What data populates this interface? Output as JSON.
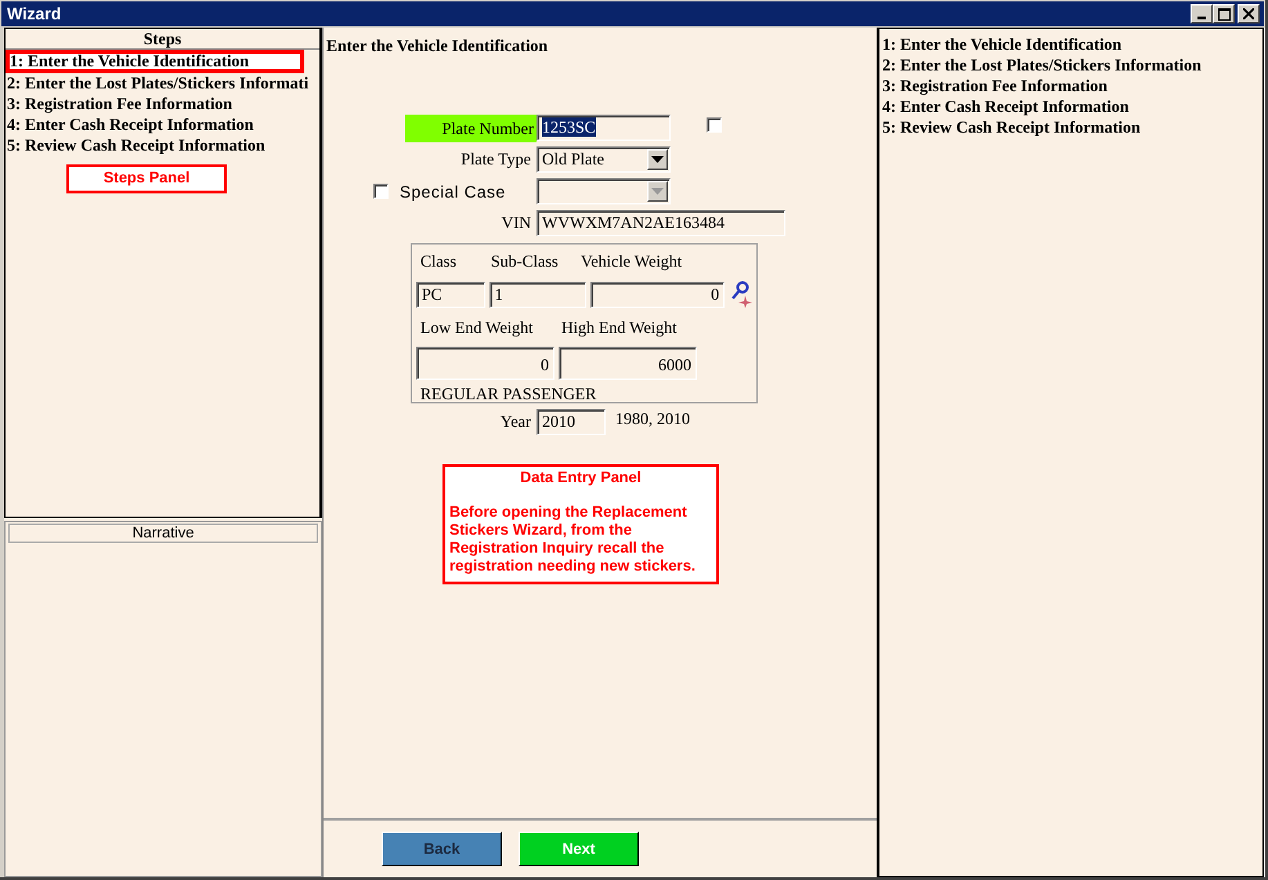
{
  "window": {
    "title": "Wizard"
  },
  "steps_panel": {
    "title": "Steps",
    "items": [
      {
        "label": "1: Enter the Vehicle Identification",
        "selected": true
      },
      {
        "label": "2: Enter the Lost Plates/Stickers Informati",
        "selected": false
      },
      {
        "label": "3: Registration Fee Information",
        "selected": false
      },
      {
        "label": "4: Enter Cash Receipt Information",
        "selected": false
      },
      {
        "label": "5: Review Cash Receipt Information",
        "selected": false
      }
    ],
    "callout": "Steps Panel"
  },
  "narrative": {
    "title": "Narrative"
  },
  "form": {
    "heading": "Enter the Vehicle Identification",
    "plate_number": {
      "label": "Plate Number",
      "value": "1253SC"
    },
    "plate_checkbox": {
      "checked": false
    },
    "plate_type": {
      "label": "Plate Type",
      "value": "Old Plate"
    },
    "special_case": {
      "label": "Special Case",
      "checked": false
    },
    "vin": {
      "label": "VIN",
      "value": "WVWXM7AN2AE163484"
    },
    "class_group": {
      "class_label": "Class",
      "subclass_label": "Sub-Class",
      "weight_label": "Vehicle  Weight",
      "class": "PC",
      "subclass": "1",
      "weight": "0",
      "low_label": "Low End Weight",
      "high_label": "High End Weight",
      "low": "0",
      "high": "6000",
      "description": "REGULAR PASSENGER"
    },
    "year": {
      "label": "Year",
      "value": "2010",
      "hint": "1980, 2010"
    },
    "callout": {
      "title": "Data Entry Panel",
      "text": "Before opening the Replacement Stickers Wizard, from the Registration Inquiry recall the registration needing new stickers."
    }
  },
  "buttons": [
    {
      "label": "Back",
      "kind": "back"
    },
    {
      "label": "Next",
      "kind": "next"
    }
  ],
  "summary_steps": [
    "1: Enter the Vehicle Identification",
    "2: Enter the Lost Plates/Stickers Information",
    "3: Registration Fee Information",
    "4: Enter Cash Receipt Information",
    "5: Review Cash Receipt Information"
  ]
}
